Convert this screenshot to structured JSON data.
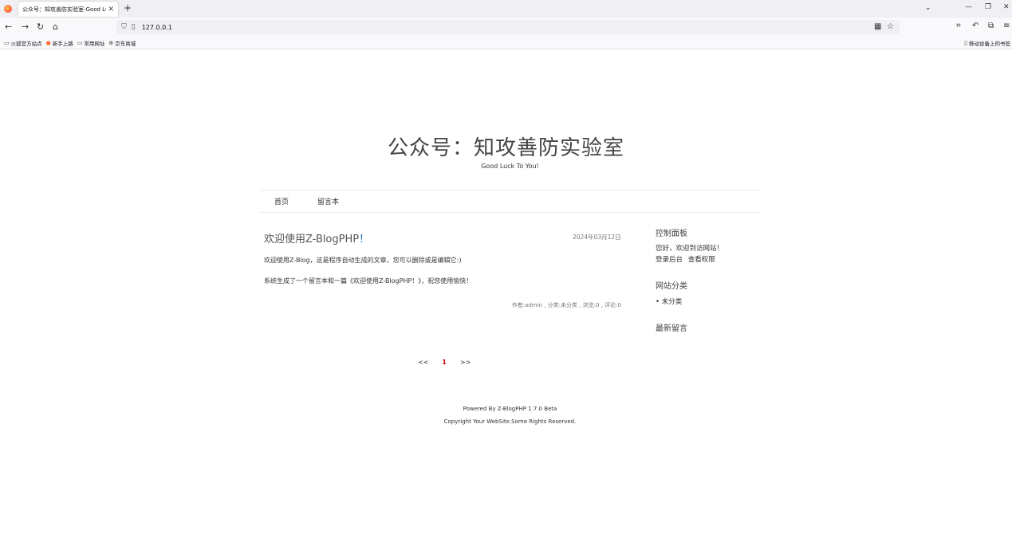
{
  "browser": {
    "tab_title": "公众号：知攻善防实验室-Good Luck To You!",
    "url": "127.0.0.1",
    "bookmarks": [
      "火狐官方站点",
      "新手上路",
      "常用网址",
      "京东商城"
    ],
    "mobile_bookmarks": "移动设备上的书签"
  },
  "site": {
    "title": "公众号：知攻善防实验室",
    "subtitle": "Good Luck To You!"
  },
  "menu": [
    "首页",
    "留言本"
  ],
  "post": {
    "title_main": "欢迎使用Z-BlogPHP",
    "title_mark": "！",
    "date": "2024年03月12日",
    "p1": "欢迎使用Z-Blog，这是程序自动生成的文章，您可以删除或是编辑它:)",
    "p2": "系统生成了一个留言本和一篇《欢迎使用Z-BlogPHP！》，祝您使用愉快！",
    "meta": "作者:admin , 分类:未分类 , 浏览:0 , 评论:0"
  },
  "sidebar": {
    "control_title": "控制面板",
    "welcome": "您好，欢迎到访网站！",
    "login": "登录后台",
    "perms": "查看权限",
    "category_title": "网站分类",
    "category_item": "• 未分类",
    "comments_title": "最新留言"
  },
  "pager": {
    "prev": "<<",
    "current": "1",
    "next": ">>"
  },
  "footer": {
    "powered": "Powered By Z-BlogPHP 1.7.0 Beta",
    "copyright": "Copyright Your WebSite.Some Rights Reserved."
  }
}
